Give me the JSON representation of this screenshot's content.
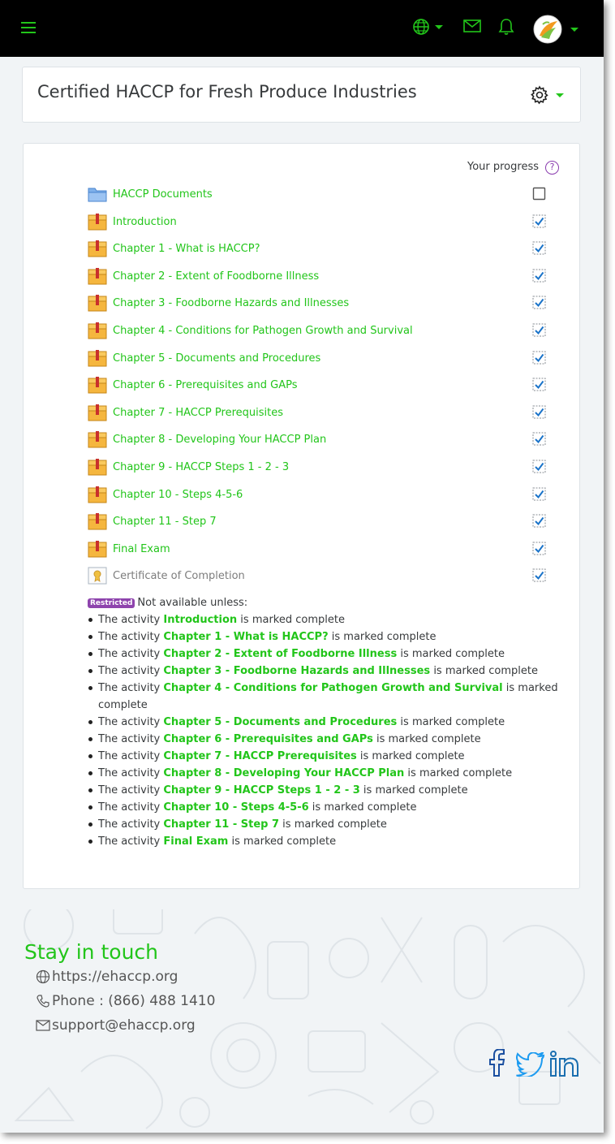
{
  "header": {
    "course_title": "Certified HACCP for Fresh Produce Industries"
  },
  "progress": {
    "label": "Your progress",
    "help_symbol": "?"
  },
  "activities": [
    {
      "label": "HACCP Documents",
      "type": "folder",
      "completed": false
    },
    {
      "label": "Introduction",
      "type": "package",
      "completed": true
    },
    {
      "label": "Chapter 1 - What is HACCP?",
      "type": "package",
      "completed": true
    },
    {
      "label": "Chapter 2 - Extent of Foodborne Illness",
      "type": "package",
      "completed": true
    },
    {
      "label": "Chapter 3 - Foodborne Hazards and Illnesses",
      "type": "package",
      "completed": true
    },
    {
      "label": "Chapter 4 - Conditions for Pathogen Growth and Survival",
      "type": "package",
      "completed": true
    },
    {
      "label": "Chapter 5 - Documents and Procedures",
      "type": "package",
      "completed": true
    },
    {
      "label": "Chapter 6 - Prerequisites and GAPs",
      "type": "package",
      "completed": true
    },
    {
      "label": "Chapter 7 - HACCP Prerequisites",
      "type": "package",
      "completed": true
    },
    {
      "label": "Chapter 8 - Developing Your HACCP Plan",
      "type": "package",
      "completed": true
    },
    {
      "label": "Chapter 9 - HACCP Steps 1 - 2 - 3",
      "type": "package",
      "completed": true
    },
    {
      "label": "Chapter 10 - Steps 4-5-6",
      "type": "package",
      "completed": true
    },
    {
      "label": "Chapter 11 - Step 7",
      "type": "package",
      "completed": true
    },
    {
      "label": "Final Exam",
      "type": "package",
      "completed": true
    },
    {
      "label": "Certificate of Completion",
      "type": "certificate",
      "completed": true
    }
  ],
  "restriction": {
    "badge": "Restricted",
    "text": "Not available unless:",
    "prefix": "The activity",
    "suffix": "is marked complete",
    "conditions": [
      "Introduction",
      "Chapter 1 - What is HACCP?",
      "Chapter 2 - Extent of Foodborne Illness",
      "Chapter 3 - Foodborne Hazards and Illnesses",
      "Chapter 4 - Conditions for Pathogen Growth and Survival",
      "Chapter 5 - Documents and Procedures",
      "Chapter 6 - Prerequisites and GAPs",
      "Chapter 7 - HACCP Prerequisites",
      "Chapter 8 - Developing Your HACCP Plan",
      "Chapter 9 - HACCP Steps 1 - 2 - 3",
      "Chapter 10 - Steps 4-5-6",
      "Chapter 11 - Step 7",
      "Final Exam"
    ]
  },
  "footer": {
    "heading": "Stay in touch",
    "website": "https://ehaccp.org",
    "phone": "Phone : (866) 488 1410",
    "email": "support@ehaccp.org"
  },
  "colors": {
    "accent": "#22c51a",
    "navbar": "#000000",
    "restricted": "#8e44ad",
    "check": "#1a73c9"
  },
  "icons": [
    "menu-icon",
    "globe-icon",
    "mail-icon",
    "bell-icon",
    "user-avatar",
    "gear-icon",
    "folder-icon",
    "package-icon",
    "certificate-icon",
    "checkbox-icon",
    "facebook-icon",
    "twitter-icon",
    "linkedin-icon"
  ]
}
